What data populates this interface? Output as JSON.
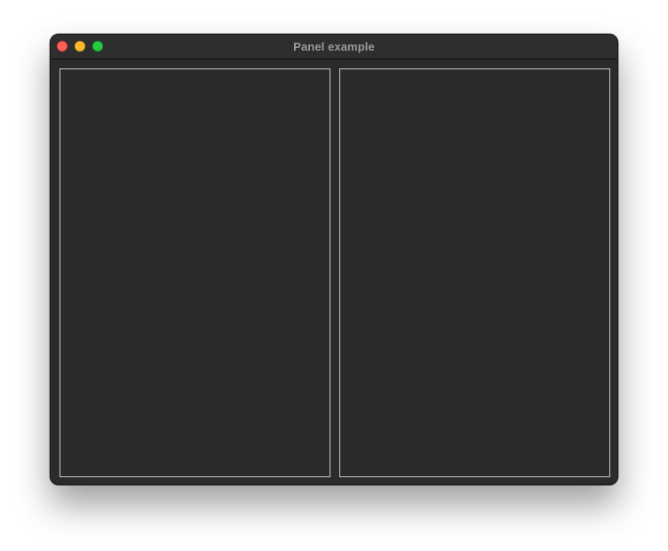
{
  "window": {
    "title": "Panel example",
    "controls": {
      "close_color": "#ff5f57",
      "minimize_color": "#febc2e",
      "zoom_color": "#28c840"
    },
    "background_color": "#2b2b2b",
    "panel_border_color": "#c8c8c8"
  },
  "panels": [
    {
      "id": "left",
      "content": ""
    },
    {
      "id": "right",
      "content": ""
    }
  ]
}
